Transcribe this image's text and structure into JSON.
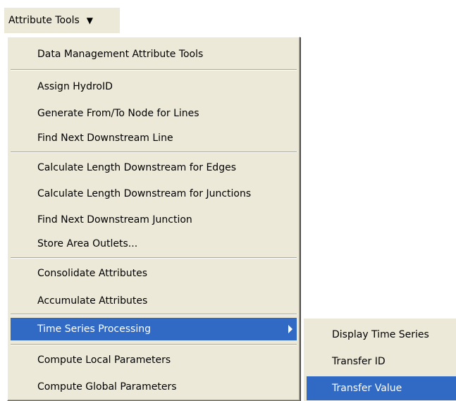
{
  "toolbar": {
    "menu_button_label": "Attribute Tools"
  },
  "menu": {
    "items": [
      {
        "label": "Data Management Attribute Tools"
      },
      {
        "label": "Assign HydroID"
      },
      {
        "label": "Generate From/To Node for Lines"
      },
      {
        "label": "Find Next Downstream Line"
      },
      {
        "label": "Calculate Length Downstream for Edges"
      },
      {
        "label": "Calculate Length Downstream for Junctions"
      },
      {
        "label": "Find Next Downstream Junction"
      },
      {
        "label": "Store Area Outlets..."
      },
      {
        "label": "Consolidate Attributes"
      },
      {
        "label": "Accumulate Attributes"
      },
      {
        "label": "Time Series Processing"
      },
      {
        "label": "Compute Local Parameters"
      },
      {
        "label": "Compute Global Parameters"
      }
    ]
  },
  "submenu": {
    "items": [
      {
        "label": "Display Time Series"
      },
      {
        "label": "Transfer ID"
      },
      {
        "label": "Transfer Value"
      }
    ]
  },
  "colors": {
    "menu_background": "#ece9d8",
    "highlight": "#316ac5",
    "highlight_text": "#ffffff"
  }
}
